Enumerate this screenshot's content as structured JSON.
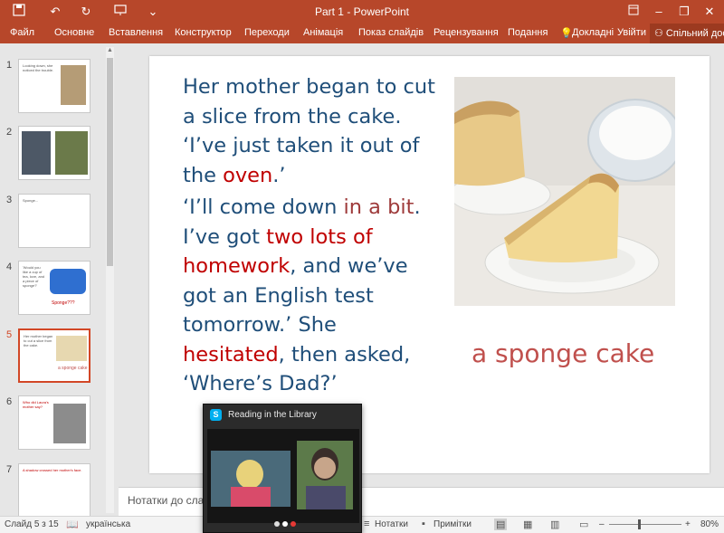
{
  "app": {
    "title": "Part 1 - PowerPoint",
    "accent": "#b7472a"
  },
  "quick_access": {
    "icons": [
      "save-icon",
      "undo-icon",
      "redo-icon",
      "presenter-icon",
      "customize-icon"
    ]
  },
  "ribbon": {
    "tabs": [
      "Файл",
      "Основне",
      "Вставлення",
      "Конструктор",
      "Переходи",
      "Анімація",
      "Показ слайдів",
      "Рецензування",
      "Подання"
    ],
    "tell_me": "Докладні",
    "sign_in": "Увійти",
    "share": "Спільний дос"
  },
  "thumbnails": [
    {
      "num": "1",
      "text": "Looking down, she noticed the trouble."
    },
    {
      "num": "2",
      "text": ""
    },
    {
      "num": "3",
      "text": "Sponge..."
    },
    {
      "num": "4",
      "text": "'Would you like a cup of tea, love, and a piece of sponge?'",
      "extra": "Sponge???"
    },
    {
      "num": "5",
      "text": "Her mother began to cut a slice from the cake.",
      "extra": "a sponge cake",
      "active": true
    },
    {
      "num": "6",
      "text": "Who did Laura's mother say?"
    },
    {
      "num": "7",
      "text": "A shadow crossed her mother's face."
    }
  ],
  "slide": {
    "paragraph1": {
      "l1": "Her mother began to cut",
      "l2": "a slice from the cake.",
      "l3": "‘I’ve just taken it out of",
      "l4a": "the ",
      "l4b": "oven",
      "l4c": ".’"
    },
    "paragraph2": {
      "a1": "‘I’ll come down ",
      "a2": "in a bit",
      "a3": ".",
      "b1": "I’ve got ",
      "b2": "two lots of",
      "c1": "homework",
      "c2": ", and we’ve",
      "d1": "got an English test",
      "e1": "tomorrow.’ She",
      "f1": "hesitated",
      "f2": ", then asked,",
      "g1": "‘Where’s Dad?’"
    },
    "caption": "a sponge cake",
    "colors": {
      "text": "#1f4e79",
      "red": "#c00000",
      "brown": "#9e3a3a",
      "caption": "#c0504d"
    }
  },
  "notes": {
    "placeholder": "Нотатки до сла"
  },
  "status": {
    "slide": "Слайд 5 з 15",
    "language": "українська",
    "notes": "Нотатки",
    "comments": "Примітки",
    "zoom": "80%",
    "zoom_minus": "–",
    "zoom_plus": "+"
  },
  "skype": {
    "title": "Reading in the Library",
    "logo": "S"
  }
}
